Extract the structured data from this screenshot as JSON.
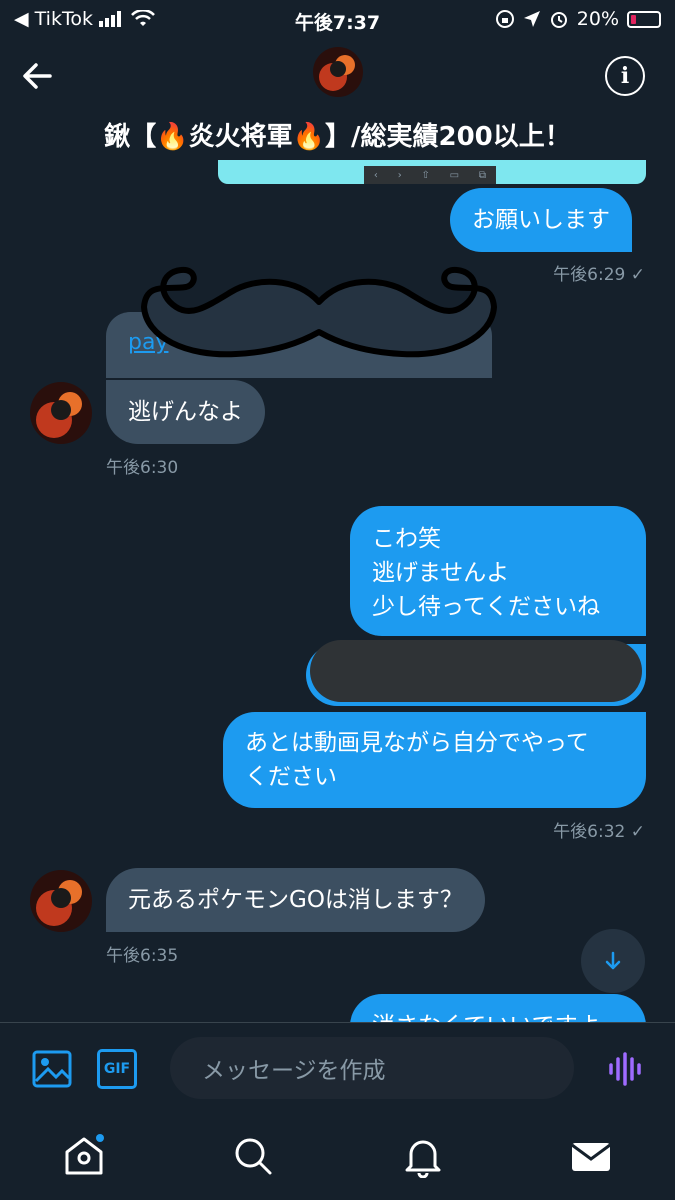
{
  "status": {
    "back_app": "◀ TikTok",
    "time": "午後7:37",
    "battery": "20%"
  },
  "header": {
    "title": "鍬【🔥炎火将軍🔥】/総実績200以上！"
  },
  "messages": {
    "m1": {
      "text": "お願いします",
      "time": "午後6:29 ✓"
    },
    "m2_link": "pay",
    "m3": {
      "text": "逃げんなよ",
      "time": "午後6:30"
    },
    "m4": {
      "l1": "こわ笑",
      "l2": "逃げませんよ",
      "l3": "少し待ってくださいね"
    },
    "m5": {
      "l1": "あとは動画見ながら自分でやって",
      "l2": "ください",
      "time": "午後6:32 ✓"
    },
    "m6": {
      "text": "元あるポケモンGOは消します？",
      "time": "午後6:35"
    },
    "m7": {
      "text": "消さなくていいですよ"
    }
  },
  "composer": {
    "placeholder": "メッセージを作成",
    "gif_label": "GIF"
  },
  "colors": {
    "background": "#15202b",
    "accent": "#1d9bf0",
    "incoming": "#3c4f61"
  },
  "icons": [
    "back-arrow-icon",
    "info-icon",
    "image-icon",
    "gif-icon",
    "voice-icon",
    "home-icon",
    "search-icon",
    "bell-icon",
    "mail-icon",
    "scroll-down-icon"
  ]
}
